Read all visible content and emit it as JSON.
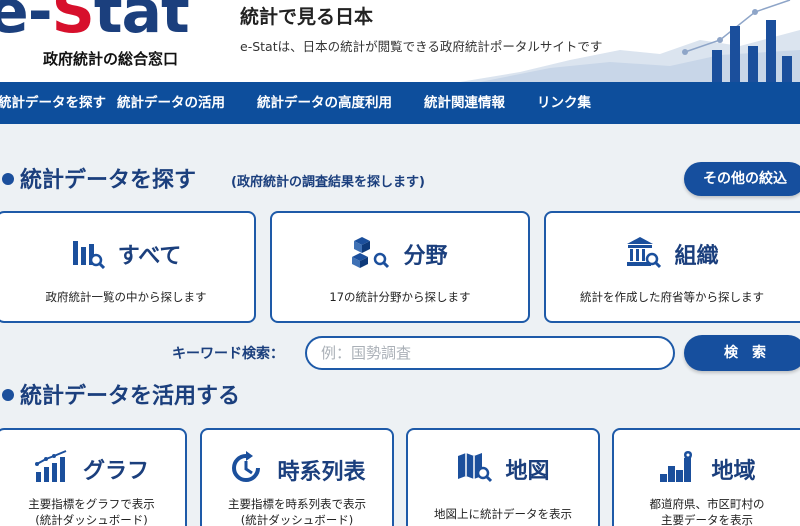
{
  "header": {
    "logo_main": "e-Stat",
    "logo_sub": "政府統計の総合窓口",
    "site_title": "統計で見る日本",
    "site_desc": "e-Statは、日本の統計が閲覧できる政府統計ポータルサイトです"
  },
  "nav": {
    "items": [
      {
        "label": "統計データを探す"
      },
      {
        "label": "統計データの活用"
      },
      {
        "label": "統計データの高度利用"
      },
      {
        "label": "統計関連情報"
      },
      {
        "label": "リンク集"
      }
    ]
  },
  "find": {
    "title": "統計データを探す",
    "subtitle": "(政府統計の調査結果を探します)",
    "other_button": "その他の絞込",
    "cards": [
      {
        "title": "すべて",
        "desc": "政府統計一覧の中から探します",
        "icon": "bar-chart-search-icon"
      },
      {
        "title": "分野",
        "desc": "17の統計分野から探します",
        "icon": "cubes-search-icon"
      },
      {
        "title": "組織",
        "desc": "統計を作成した府省等から探します",
        "icon": "building-search-icon"
      }
    ],
    "keyword_label": "キーワード検索：",
    "keyword_placeholder": "例：国勢調査",
    "search_button": "検　索"
  },
  "use": {
    "title": "統計データを活用する",
    "cards": [
      {
        "title": "グラフ",
        "desc_line1": "主要指標をグラフで表示",
        "desc_line2": "(統計ダッシュボード)",
        "icon": "graph-icon"
      },
      {
        "title": "時系列表",
        "desc_line1": "主要指標を時系列表で表示",
        "desc_line2": "(統計ダッシュボード)",
        "icon": "clock-arrow-icon"
      },
      {
        "title": "地図",
        "desc_line1": "地図上に統計データを表示",
        "desc_line2": "",
        "icon": "map-search-icon"
      },
      {
        "title": "地域",
        "desc_line1": "都道府県、市区町村の",
        "desc_line2": "主要データを表示",
        "icon": "region-bars-icon"
      }
    ]
  },
  "colors": {
    "brand_blue": "#1b3f7d",
    "nav_blue": "#0d4e9c",
    "accent_red": "#d7102c",
    "background": "#edf1f4"
  }
}
